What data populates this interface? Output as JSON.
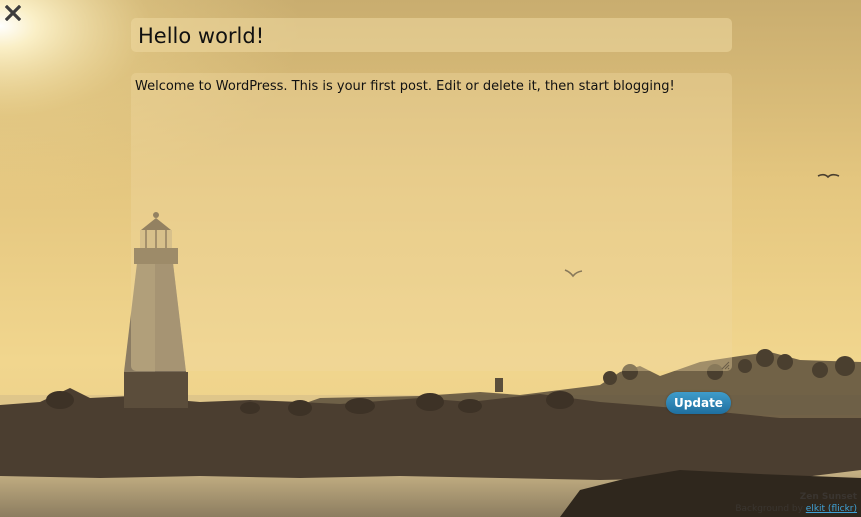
{
  "editor": {
    "title_value": "Hello world!",
    "content_value": "Welcome to WordPress. This is your first post. Edit or delete it, then start blogging!",
    "update_label": "Update",
    "close_icon": "close-icon"
  },
  "background": {
    "credit_title": "Zen Sunset",
    "credit_prefix": "Background by ",
    "credit_author": "elkit (flickr)"
  },
  "colors": {
    "accent": "#2a85b8",
    "sky": "#e8cf8c"
  }
}
